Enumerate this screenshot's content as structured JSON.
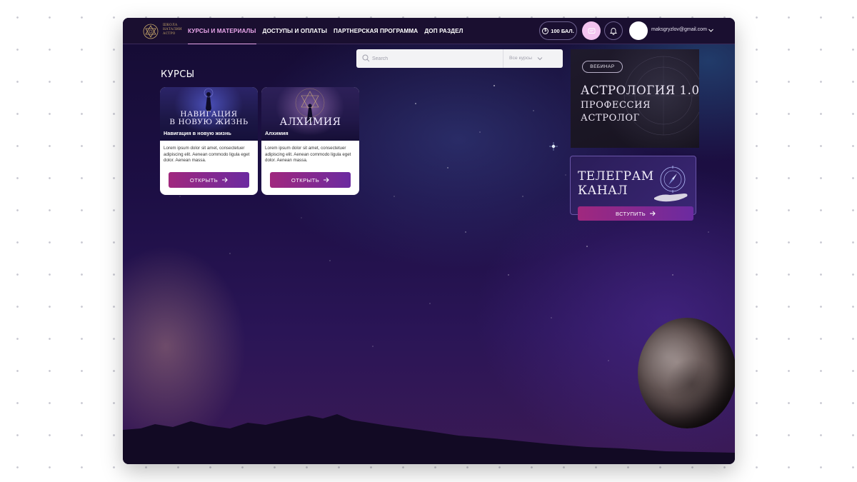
{
  "brand": {
    "logo_text": "ШКОЛА НАТАЛИИ АСТРО"
  },
  "nav": {
    "items": [
      {
        "label": "КУРСЫ И МАТЕРИАЛЫ",
        "active": true
      },
      {
        "label": "ДОСТУПЫ И ОПЛАТЫ",
        "active": false
      },
      {
        "label": "ПАРТНЕРСКАЯ ПРОГРАММА",
        "active": false
      },
      {
        "label": "ДОП РАЗДЕЛ",
        "active": false
      }
    ]
  },
  "header": {
    "points_label": "100 БАЛ.",
    "coin_symbol": "$",
    "user_email": "maksgryzlov@gmail.com"
  },
  "search": {
    "placeholder": "Search",
    "filter_label": "Все курсы"
  },
  "courses": {
    "section_title": "КУРСЫ",
    "items": [
      {
        "image_title_line1": "НАВИГАЦИЯ",
        "image_title_line2": "В НОВУЮ ЖИЗНЬ",
        "name": "Навигация в новую жизнь",
        "description": "Lorem ipsum dolor sit amet, consectetuer adipiscing elit. Aenean commodo ligula eget dolor. Aenean massa.",
        "button_label": "ОТКРЫТЬ"
      },
      {
        "image_title_line1": "АЛХИМИЯ",
        "image_title_line2": "",
        "name": "Алхимия",
        "description": "Lorem ipsum dolor sit amet, consectetuer adipiscing elit. Aenean commodo ligula eget dolor. Aenean massa.",
        "button_label": "ОТКРЫТЬ"
      }
    ]
  },
  "webinar": {
    "badge": "ВЕБИНАР",
    "title": "АСТРОЛОГИЯ 1.0",
    "subtitle_line1": "ПРОФЕССИЯ",
    "subtitle_line2": "АСТРОЛОГ"
  },
  "telegram": {
    "title_line1": "ТЕЛЕГРАМ",
    "title_line2": "КАНАЛ",
    "button_label": "ВСТУПИТЬ"
  },
  "colors": {
    "accent_pink": "#e9a6ea",
    "button_gradient_start": "#a0287e",
    "button_gradient_end": "#6b2aa0",
    "header_bg": "#1a0f30"
  }
}
